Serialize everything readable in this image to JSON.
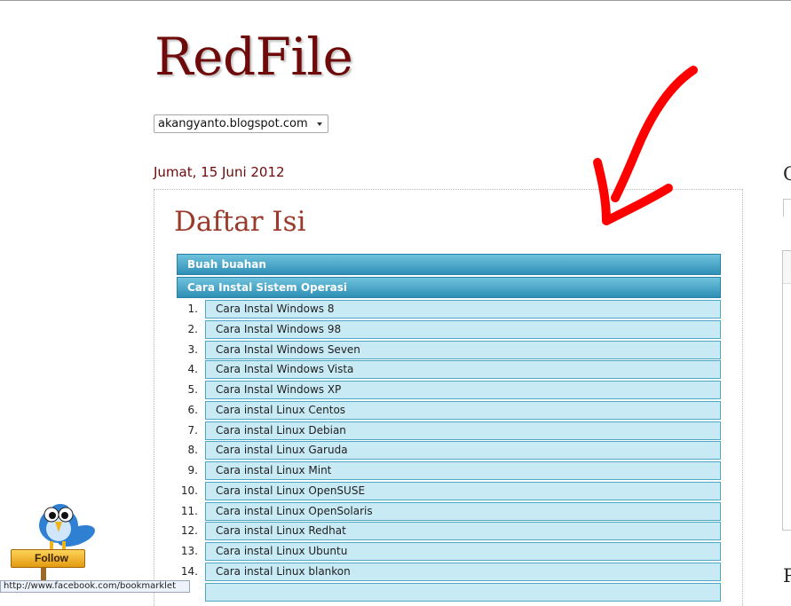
{
  "blog": {
    "title": "RedFile",
    "selector_value": "akangyanto.blogspot.com"
  },
  "post": {
    "date": "Jumat, 15 Juni 2012",
    "title": "Daftar Isi"
  },
  "categories": [
    {
      "label": "Buah buahan"
    },
    {
      "label": "Cara Instal Sistem Operasi"
    }
  ],
  "articles": [
    {
      "number": "1.",
      "title": "Cara Instal Windows 8"
    },
    {
      "number": "2.",
      "title": "Cara Instal Windows 98"
    },
    {
      "number": "3.",
      "title": "Cara Instal Windows Seven"
    },
    {
      "number": "4.",
      "title": "Cara Instal Windows Vista"
    },
    {
      "number": "5.",
      "title": "Cara Instal Windows XP"
    },
    {
      "number": "6.",
      "title": "Cara instal Linux Centos"
    },
    {
      "number": "7.",
      "title": "Cara instal Linux Debian"
    },
    {
      "number": "8.",
      "title": "Cara instal Linux Garuda"
    },
    {
      "number": "9.",
      "title": "Cara instal Linux Mint"
    },
    {
      "number": "10.",
      "title": "Cara instal Linux OpenSUSE"
    },
    {
      "number": "11.",
      "title": "Cara instal Linux OpenSolaris"
    },
    {
      "number": "12.",
      "title": "Cara instal Linux Redhat"
    },
    {
      "number": "13.",
      "title": "Cara instal Linux Ubuntu"
    },
    {
      "number": "14.",
      "title": "Cara instal Linux blankon"
    }
  ],
  "sidebar": {
    "heading_1_partial": "C",
    "heading_2_partial": "P"
  },
  "follow_widget": {
    "label": "Follow",
    "mascot_icon": "twitter-bird-icon"
  },
  "status_bar": {
    "url_text": "http://www.facebook.com/bookmarklet"
  },
  "colors": {
    "blog_title": "#6e0a0a",
    "post_title": "#993a2b",
    "category_bar": "#2f8fb6",
    "article_bg": "#c8eaf5",
    "annotation_arrow": "#ff0000"
  }
}
